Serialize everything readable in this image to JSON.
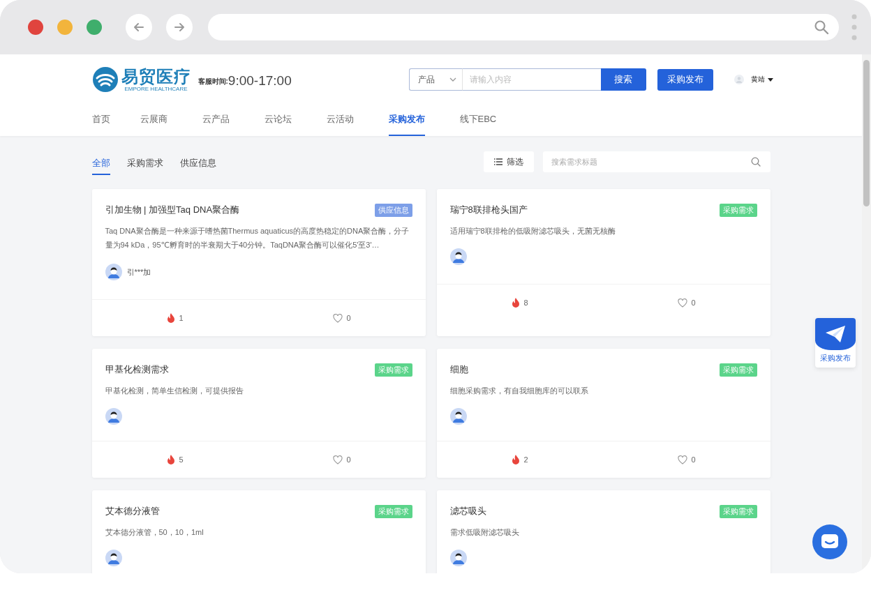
{
  "header": {
    "logo": {
      "name": "易贸医疗",
      "subtitle": "EMPORE HEALTHCARE"
    },
    "service_label": "客服时间:",
    "service_hours": "9:00-17:00",
    "search": {
      "category": "产品",
      "placeholder": "请输入内容",
      "button": "搜索"
    },
    "publish_button": "采购发布",
    "user": "黄靖"
  },
  "nav": [
    {
      "label": "首页",
      "selected": false
    },
    {
      "label": "云展商",
      "selected": false
    },
    {
      "label": "云产品",
      "selected": false
    },
    {
      "label": "云论坛",
      "selected": false
    },
    {
      "label": "云活动",
      "selected": false
    },
    {
      "label": "采购发布",
      "selected": true
    },
    {
      "label": "线下EBC",
      "selected": false
    }
  ],
  "filter_tabs": [
    {
      "label": "全部",
      "selected": true
    },
    {
      "label": "采购需求",
      "selected": false
    },
    {
      "label": "供应信息",
      "selected": false
    }
  ],
  "filter_button": "筛选",
  "title_search": {
    "placeholder": "搜索需求标题"
  },
  "cards": [
    {
      "title": "引加生物 | 加强型Taq DNA聚合酶",
      "tag": {
        "label": "供应信息",
        "kind": "supply"
      },
      "description": "Taq DNA聚合酶是一种来源于嗜热菌Thermus aquaticus的高度热稳定的DNA聚合酶，分子量为94 kDa，95℃孵育时的半衰期大于40分钟。TaqDNA聚合酶可以催化5'至3'…",
      "user": "引***加",
      "hot": "1",
      "likes": "0"
    },
    {
      "title": "瑞宁8联排枪头国产",
      "tag": {
        "label": "采购需求",
        "kind": "demand"
      },
      "description": "适用瑞宁8联排枪的低吸附滤芯吸头，无菌无核酶",
      "hot": "8",
      "likes": "0"
    },
    {
      "title": "甲基化检测需求",
      "tag": {
        "label": "采购需求",
        "kind": "demand"
      },
      "description": "甲基化检测，简单生信检测，可提供报告",
      "hot": "5",
      "likes": "0"
    },
    {
      "title": "细胞",
      "tag": {
        "label": "采购需求",
        "kind": "demand"
      },
      "description": "细胞采购需求，有自我细胞库的可以联系",
      "hot": "2",
      "likes": "0"
    },
    {
      "title": "艾本德分液管",
      "tag": {
        "label": "采购需求",
        "kind": "demand"
      },
      "description": "艾本德分液管，50，10，1ml"
    },
    {
      "title": "滤芯吸头",
      "tag": {
        "label": "采购需求",
        "kind": "demand"
      },
      "description": "需求低吸附滤芯吸头"
    }
  ],
  "float_button": "采购发布"
}
